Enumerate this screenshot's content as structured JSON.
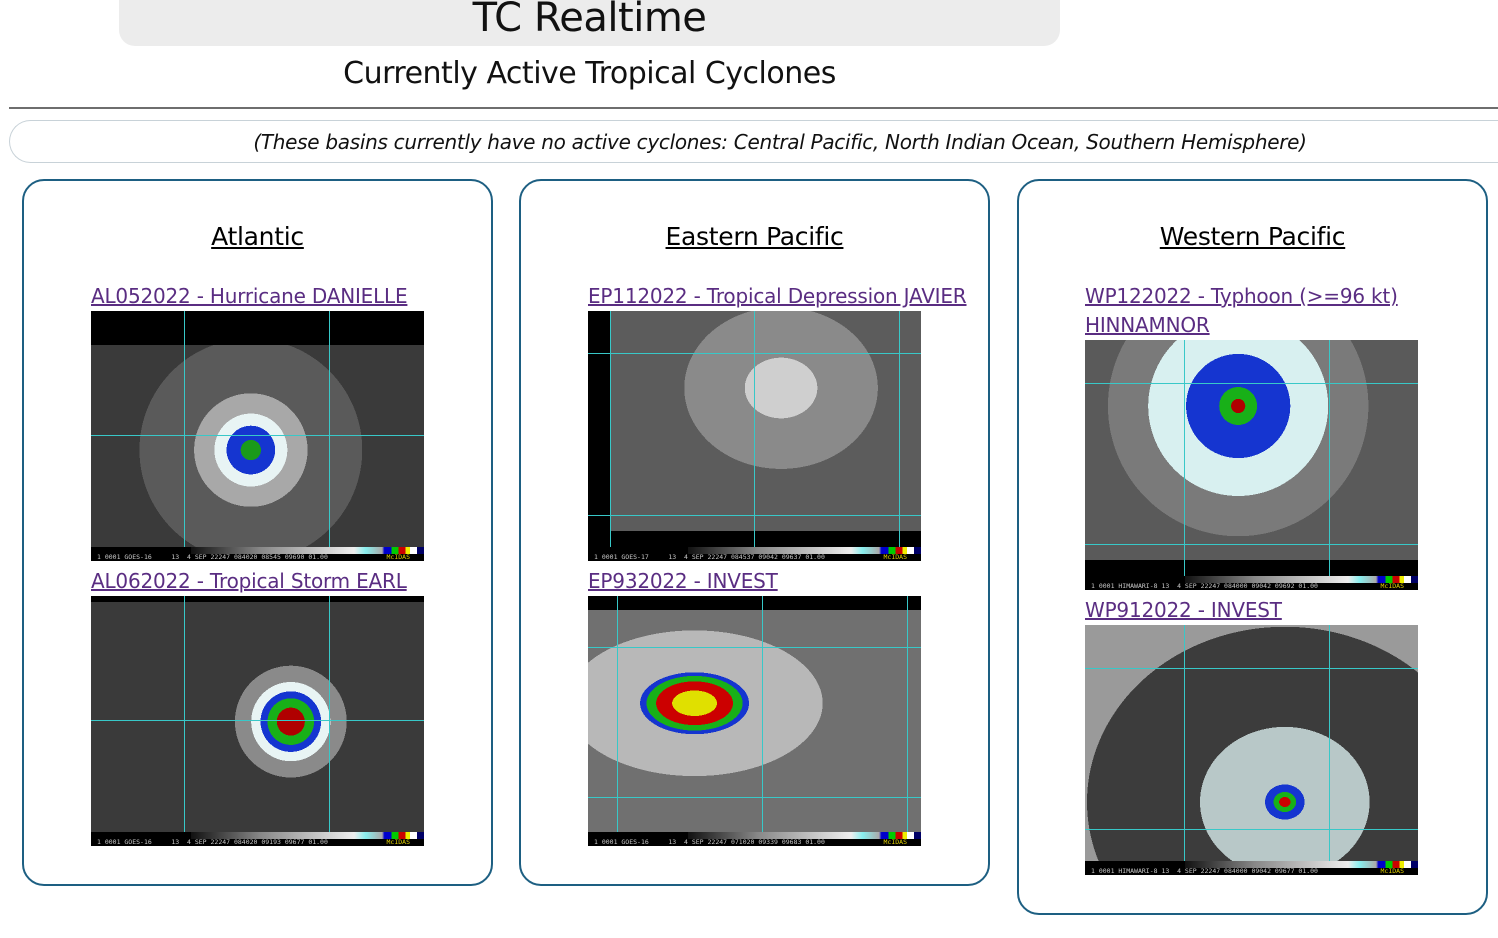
{
  "header": {
    "title": "TC Realtime",
    "subtitle": "Currently Active Tropical Cyclones"
  },
  "notice": "(These basins currently have no active cyclones: Central Pacific, North Indian Ocean, Southern Hemisphere)",
  "colors": {
    "panel_border": "#1d5f82",
    "link": "#5a2d82",
    "title_bar": "#ececec"
  },
  "basins": [
    {
      "name": "Atlantic",
      "storms": [
        {
          "label": "AL052022 - Hurricane DANIELLE",
          "image_caption": "1 0001 GOES-16     13  4 SEP 22247 084020 08545 09690 01.00",
          "image_logo": "McIDAS"
        },
        {
          "label": "AL062022 - Tropical Storm EARL",
          "image_caption": "1 0001 GOES-16     13  4 SEP 22247 084020 09193 09677 01.00",
          "image_logo": "McIDAS"
        }
      ]
    },
    {
      "name": "Eastern Pacific",
      "storms": [
        {
          "label": "EP112022 - Tropical Depression JAVIER",
          "image_caption": "1 0001 GOES-17     13  4 SEP 22247 084537 09042 09637 01.00",
          "image_logo": "McIDAS"
        },
        {
          "label": "EP932022 - INVEST",
          "image_caption": "1 0001 GOES-16     13  4 SEP 22247 071020 09339 09683 01.00",
          "image_logo": "McIDAS"
        }
      ]
    },
    {
      "name": "Western Pacific",
      "storms": [
        {
          "label_line1": "WP122022 - Typhoon (>=96 kt)",
          "label_line2": "HINNAMNOR",
          "image_caption": "1 0001 HIMAWARI-8 13  4 SEP 22247 084000 09042 09692 01.00",
          "image_logo": "McIDAS"
        },
        {
          "label": "WP912022 - INVEST",
          "image_caption": "1 0001 HIMAWARI-8 13  4 SEP 22247 084000 09042 09677 01.00",
          "image_logo": "McIDAS"
        }
      ]
    }
  ]
}
